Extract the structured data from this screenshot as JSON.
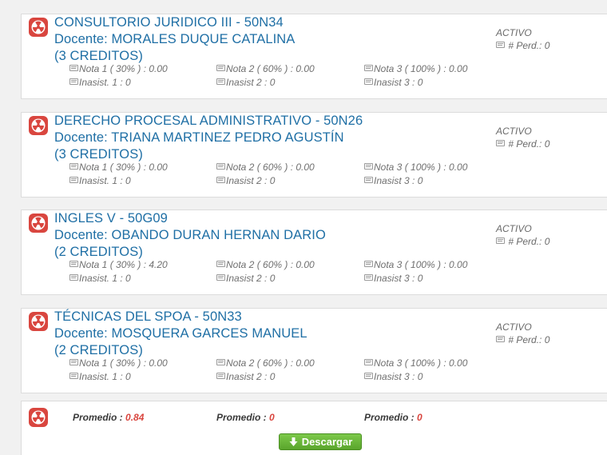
{
  "courses": [
    {
      "title": "CONSULTORIO JURIDICO III  -  50N34",
      "teacher": "Docente: MORALES DUQUE CATALINA",
      "credits": "(3 CREDITOS)",
      "nota1": "Nota 1 ( 30% ) : 0.00",
      "nota2": "Nota 2 ( 60% ) : 0.00",
      "nota3": "Nota 3 ( 100% ) : 0.00",
      "inasist1": "Inasist. 1 : 0",
      "inasist2": "Inasist 2 : 0",
      "inasist3": "Inasist 3 : 0",
      "status": "ACTIVO",
      "perd": "# Perd.: 0"
    },
    {
      "title": "DERECHO PROCESAL ADMINISTRATIVO  -  50N26",
      "teacher": "Docente: TRIANA MARTINEZ PEDRO AGUSTÍN",
      "credits": "(3 CREDITOS)",
      "nota1": "Nota 1 ( 30% ) : 0.00",
      "nota2": "Nota 2 ( 60% ) : 0.00",
      "nota3": "Nota 3 ( 100% ) : 0.00",
      "inasist1": "Inasist. 1 : 0",
      "inasist2": "Inasist 2 : 0",
      "inasist3": "Inasist 3 : 0",
      "status": "ACTIVO",
      "perd": "# Perd.: 0"
    },
    {
      "title": "INGLES V  -  50G09",
      "teacher": "Docente: OBANDO DURAN HERNAN DARIO",
      "credits": "(2 CREDITOS)",
      "nota1": "Nota 1 ( 30% ) : 4.20",
      "nota2": "Nota 2 ( 60% ) : 0.00",
      "nota3": "Nota 3 ( 100% ) : 0.00",
      "inasist1": "Inasist. 1 : 0",
      "inasist2": "Inasist 2 : 0",
      "inasist3": "Inasist 3 : 0",
      "status": "ACTIVO",
      "perd": "# Perd.: 0"
    },
    {
      "title": "TÉCNICAS DEL SPOA  -  50N33",
      "teacher": "Docente: MOSQUERA GARCES MANUEL",
      "credits": "(2 CREDITOS)",
      "nota1": "Nota 1 ( 30% ) : 0.00",
      "nota2": "Nota 2 ( 60% ) : 0.00",
      "nota3": "Nota 3 ( 100% ) : 0.00",
      "inasist1": "Inasist. 1 : 0",
      "inasist2": "Inasist 2 : 0",
      "inasist3": "Inasist 3 : 0",
      "status": "ACTIVO",
      "perd": "# Perd.: 0"
    }
  ],
  "summary": {
    "label1": "Promedio :",
    "value1": "0.84",
    "label2": "Promedio :",
    "value2": "0",
    "label3": "Promedio :",
    "value3": "0",
    "download_label": "Descargar"
  },
  "icons": {
    "course": "radiation-icon",
    "note": "message-icon",
    "download": "download-arrow-icon"
  },
  "colors": {
    "accent_red": "#d9463f",
    "link_blue": "#1f6fa5",
    "button_green": "#5aa52c"
  }
}
